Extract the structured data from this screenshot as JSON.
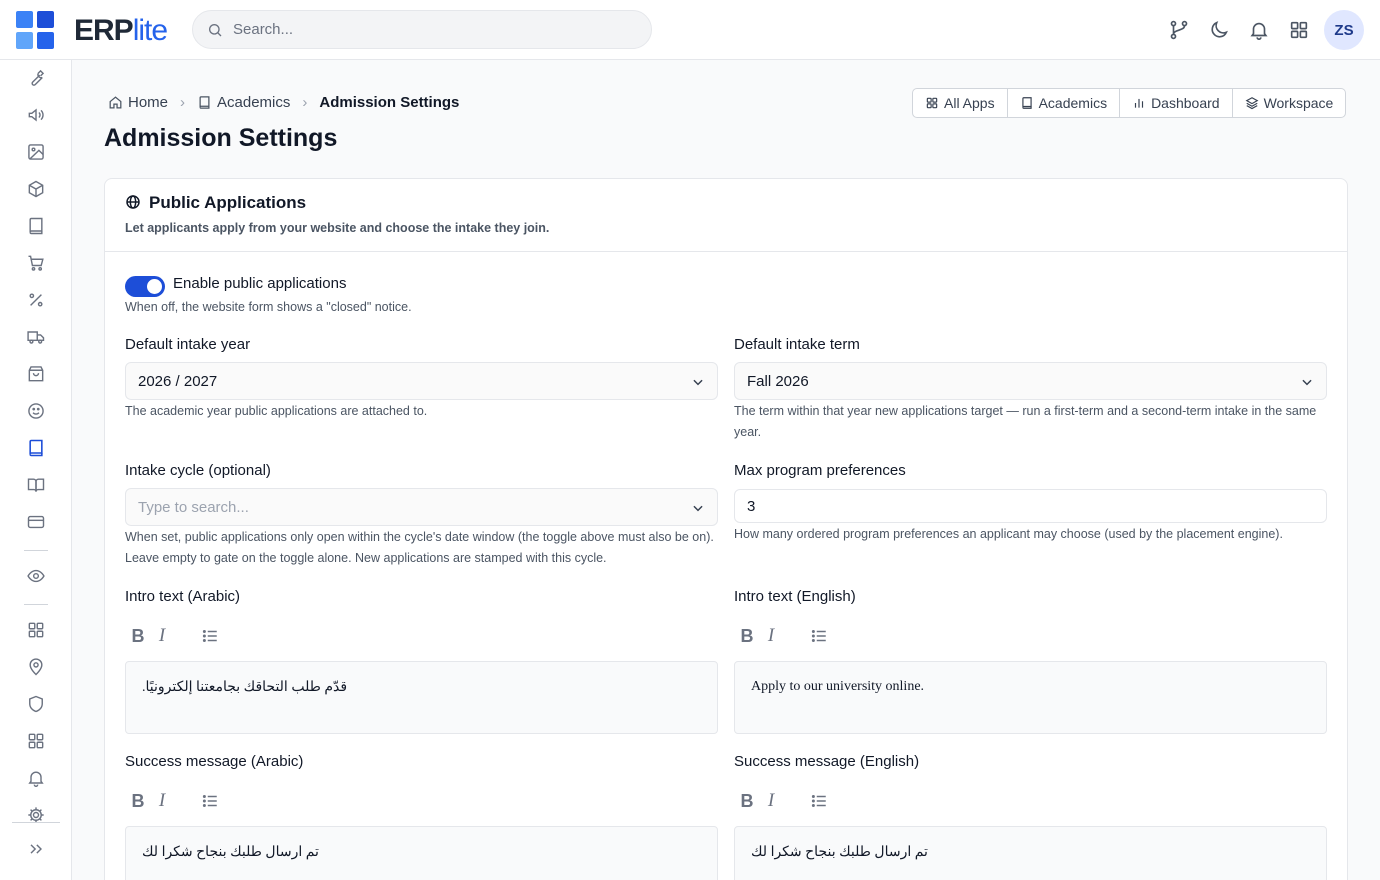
{
  "app": {
    "logo_bold": "ERP",
    "logo_light": "lite",
    "search_placeholder": "Search...",
    "user_initials": "ZS",
    "accent": "#1d4ed8"
  },
  "topbar_icons": [
    "git-branch-icon",
    "moon-icon",
    "bell-icon",
    "apps-grid-icon"
  ],
  "sidebar_icons": [
    "wrench-icon",
    "megaphone-icon",
    "image-icon",
    "box-icon",
    "book-icon",
    "cart-icon",
    "percent-icon",
    "truck-icon",
    "shopping-bag-icon",
    "smile-icon",
    "book-active-icon",
    "book-open-icon",
    "credit-card-icon",
    "eye-icon",
    "grid-icon",
    "map-pin-icon",
    "shield-icon",
    "grid-2-icon",
    "bell-icon",
    "gear-icon",
    "double-chevron-icon"
  ],
  "breadcrumb": {
    "home": "Home",
    "academics": "Academics",
    "current": "Admission Settings"
  },
  "page_title": "Admission Settings",
  "app_switcher": {
    "all_apps": "All Apps",
    "academics": "Academics",
    "dashboard": "Dashboard",
    "workspace": "Workspace"
  },
  "card": {
    "title": "Public Applications",
    "subtitle": "Let applicants apply from your website and choose the intake they join.",
    "toggle": {
      "label": "Enable public applications",
      "enabled": true,
      "help": "When off, the website form shows a \"closed\" notice."
    },
    "intake_year": {
      "label": "Default intake year",
      "value": "2026 / 2027",
      "help": "The academic year public applications are attached to."
    },
    "intake_term": {
      "label": "Default intake term",
      "value": "Fall 2026",
      "help": "The term within that year new applications target — run a first-term and a second-term intake in the same year."
    },
    "intake_cycle": {
      "label": "Intake cycle (optional)",
      "placeholder": "Type to search...",
      "help": "When set, public applications only open within the cycle's date window (the toggle above must also be on). Leave empty to gate on the toggle alone. New applications are stamped with this cycle."
    },
    "max_prefs": {
      "label": "Max program preferences",
      "value": "3",
      "help": "How many ordered program preferences an applicant may choose (used by the placement engine)."
    },
    "intro_ar": {
      "label": "Intro text (Arabic)",
      "content": "قدّم طلب التحاقك بجامعتنا إلكترونيًا."
    },
    "intro_en": {
      "label": "Intro text (English)",
      "content": "Apply to our university online."
    },
    "success_ar": {
      "label": "Success message (Arabic)",
      "content": "تم ارسال طلبك بنجاح شكرا لك"
    },
    "success_en": {
      "label": "Success message (English)",
      "content": "تم ارسال طلبك بنجاح شكرا لك"
    },
    "toolbar": {
      "bold": "B",
      "italic": "I"
    }
  }
}
